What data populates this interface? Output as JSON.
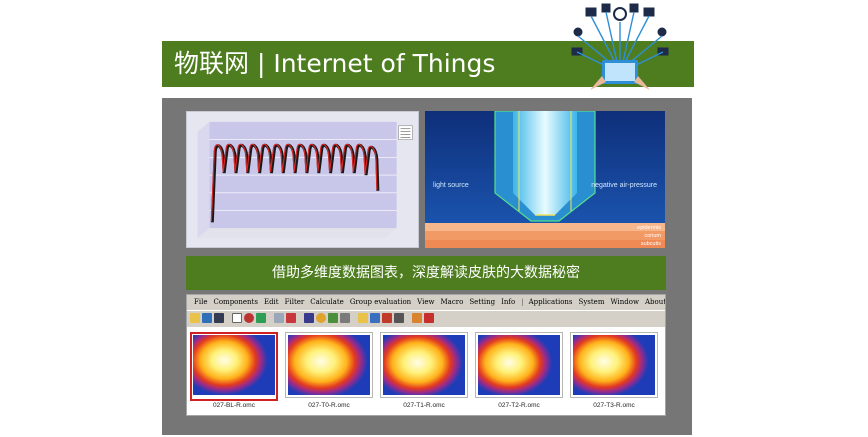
{
  "header": {
    "title": "物联网 | Internet of Things",
    "illustration": "iot-network-illustration"
  },
  "images": {
    "chart": "response-curve-chart-screenshot",
    "sensor": {
      "label_left": "light source",
      "label_right": "negative air-pressure",
      "layers": [
        "epidermis",
        "corium",
        "subcutis"
      ]
    }
  },
  "banner": {
    "text": "借助多维度数据图表，深度解读皮肤的大数据秘密"
  },
  "app": {
    "menu": [
      "File",
      "Components",
      "Edit",
      "Filter",
      "Calculate",
      "Group evaluation",
      "View",
      "Macro",
      "Setting",
      "Info"
    ],
    "menu_right": [
      "Applications",
      "System",
      "Window",
      "About"
    ],
    "thumbnails": [
      {
        "label": "027-BL-R.omc",
        "selected": true
      },
      {
        "label": "027-T0-R.omc",
        "selected": false
      },
      {
        "label": "027-T1-R.omc",
        "selected": false
      },
      {
        "label": "027-T2-R.omc",
        "selected": false
      },
      {
        "label": "027-T3-R.omc",
        "selected": false
      }
    ]
  },
  "colors": {
    "accent_green": "#4e7d1f",
    "panel_gray": "#767676",
    "selection_red": "#d0201f"
  }
}
